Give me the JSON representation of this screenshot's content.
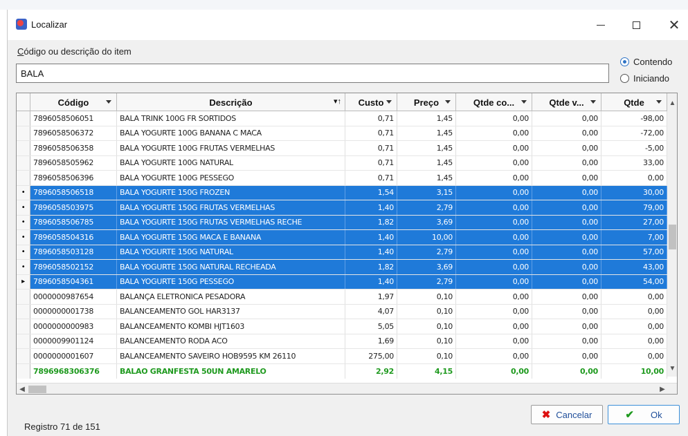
{
  "window": {
    "title": "Localizar"
  },
  "search": {
    "label_underlined": "C",
    "label_rest": "ódigo ou descrição do item",
    "value": "BALA",
    "options": [
      {
        "label": "Contendo",
        "checked": true
      },
      {
        "label": "Iniciando",
        "checked": false
      }
    ]
  },
  "grid": {
    "columns": [
      "Código",
      "Descrição",
      "Custo",
      "Preço",
      "Qtde co...",
      "Qtde v...",
      "Qtde"
    ],
    "rows": [
      {
        "ind": "",
        "cells": [
          "7896058506051",
          "BALA TRINK 100G FR SORTIDOS",
          "0,71",
          "1,45",
          "0,00",
          "0,00",
          "-98,00"
        ],
        "state": "normal"
      },
      {
        "ind": "",
        "cells": [
          "7896058506372",
          "BALA YOGURTE 100G BANANA C MACA",
          "0,71",
          "1,45",
          "0,00",
          "0,00",
          "-72,00"
        ],
        "state": "normal"
      },
      {
        "ind": "",
        "cells": [
          "7896058506358",
          "BALA YOGURTE 100G FRUTAS VERMELHAS",
          "0,71",
          "1,45",
          "0,00",
          "0,00",
          "-5,00"
        ],
        "state": "normal"
      },
      {
        "ind": "",
        "cells": [
          "7896058505962",
          "BALA YOGURTE 100G NATURAL",
          "0,71",
          "1,45",
          "0,00",
          "0,00",
          "33,00"
        ],
        "state": "normal"
      },
      {
        "ind": "",
        "cells": [
          "7896058506396",
          "BALA YOGURTE 100G PESSEGO",
          "0,71",
          "1,45",
          "0,00",
          "0,00",
          "0,00"
        ],
        "state": "normal"
      },
      {
        "ind": "•",
        "cells": [
          "7896058506518",
          "BALA YOGURTE 150G FROZEN",
          "1,54",
          "3,15",
          "0,00",
          "0,00",
          "30,00"
        ],
        "state": "selected"
      },
      {
        "ind": "•",
        "cells": [
          "7896058503975",
          "BALA YOGURTE 150G FRUTAS VERMELHAS",
          "1,40",
          "2,79",
          "0,00",
          "0,00",
          "79,00"
        ],
        "state": "selected"
      },
      {
        "ind": "•",
        "cells": [
          "7896058506785",
          "BALA YOGURTE 150G FRUTAS VERMELHAS RECHE",
          "1,82",
          "3,69",
          "0,00",
          "0,00",
          "27,00"
        ],
        "state": "selected"
      },
      {
        "ind": "•",
        "cells": [
          "7896058504316",
          "BALA YOGURTE 150G MACA E BANANA",
          "1,40",
          "10,00",
          "0,00",
          "0,00",
          "7,00"
        ],
        "state": "selected"
      },
      {
        "ind": "•",
        "cells": [
          "7896058503128",
          "BALA YOGURTE 150G NATURAL",
          "1,40",
          "2,79",
          "0,00",
          "0,00",
          "57,00"
        ],
        "state": "selected"
      },
      {
        "ind": "•",
        "cells": [
          "7896058502152",
          "BALA YOGURTE 150G NATURAL RECHEADA",
          "1,82",
          "3,69",
          "0,00",
          "0,00",
          "43,00"
        ],
        "state": "selected"
      },
      {
        "ind": "▸",
        "cells": [
          "7896058504361",
          "BALA YOGURTE 150G PESSEGO",
          "1,40",
          "2,79",
          "0,00",
          "0,00",
          "54,00"
        ],
        "state": "selected"
      },
      {
        "ind": "",
        "cells": [
          "0000000987654",
          "BALANÇA ELETRONICA PESADORA",
          "1,97",
          "0,10",
          "0,00",
          "0,00",
          "0,00"
        ],
        "state": "normal"
      },
      {
        "ind": "",
        "cells": [
          "0000000001738",
          "BALANCEAMENTO GOL HAR3137",
          "4,07",
          "0,10",
          "0,00",
          "0,00",
          "0,00"
        ],
        "state": "normal"
      },
      {
        "ind": "",
        "cells": [
          "0000000000983",
          "BALANCEAMENTO KOMBI HJT1603",
          "5,05",
          "0,10",
          "0,00",
          "0,00",
          "0,00"
        ],
        "state": "normal"
      },
      {
        "ind": "",
        "cells": [
          "0000009901124",
          "BALANCEAMENTO RODA ACO",
          "1,69",
          "0,10",
          "0,00",
          "0,00",
          "0,00"
        ],
        "state": "normal"
      },
      {
        "ind": "",
        "cells": [
          "0000000001607",
          "BALANCEAMENTO SAVEIRO HOB9595 KM 26110",
          "275,00",
          "0,10",
          "0,00",
          "0,00",
          "0,00"
        ],
        "state": "normal"
      },
      {
        "ind": "",
        "cells": [
          "7896968306376",
          "BALAO GRANFESTA 50UN AMARELO",
          "2,92",
          "4,15",
          "0,00",
          "0,00",
          "10,00"
        ],
        "state": "green"
      }
    ]
  },
  "buttons": {
    "cancel": "Cancelar",
    "ok": "Ok"
  },
  "status": "Registro 71 de 151",
  "colors": {
    "selection": "#1f7ad9",
    "highlight_text": "#1f9a1f",
    "radio_accent": "#2e73c5"
  }
}
